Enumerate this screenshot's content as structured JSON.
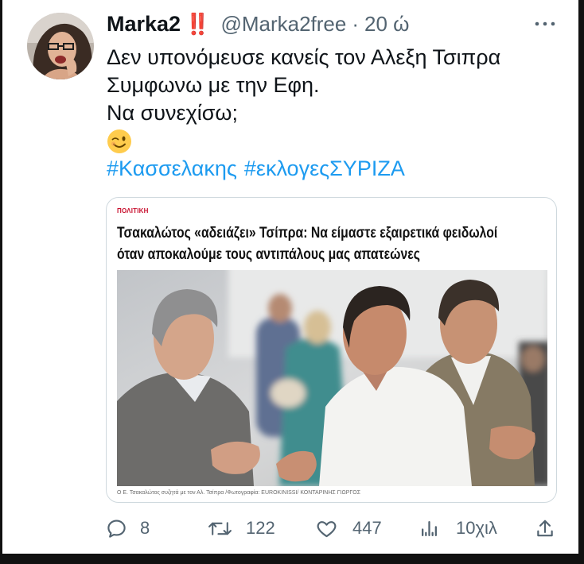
{
  "tweet": {
    "author": {
      "avatar_icon": "avatar",
      "display_name": "Marka2",
      "name_emoji": "‼️",
      "handle": "@Marka2free",
      "separator": "·",
      "time": "20 ώ"
    },
    "more_icon": "more-horizontal-icon",
    "text_lines": [
      "Δεν υπονόμευσε κανείς τον Αλεξη Τσιπρα",
      "Συμφωνω με την Εφη.",
      "Να συνεχίσω;"
    ],
    "emoji_icon": "winking-face-emoji",
    "hashtags": [
      "#Κασσελακης",
      "#εκλογεςΣΥΡΙΖΑ"
    ],
    "card": {
      "category": "ΠΟΛΙΤΙΚΗ",
      "headline_lines": [
        "Τσακαλώτος «αδειάζει» Τσίπρα: Να είμαστε εξαιρετικά φειδωλοί",
        "όταν αποκαλούμε τους αντιπάλους μας απατεώνες"
      ],
      "photo_icon": "article-photo",
      "caption": "Ο Ε. Τσακαλώτος συζητά με τον Αλ. Τσίπρα /Φωτογραφία: EUROKINISSI/ ΚΟΝΤΑΡΙΝΗΣ ΓΙΩΡΓΟΣ"
    },
    "actions": {
      "reply": {
        "icon": "reply-icon",
        "count": "8"
      },
      "retweet": {
        "icon": "retweet-icon",
        "count": "122"
      },
      "like": {
        "icon": "heart-icon",
        "count": "447"
      },
      "views": {
        "icon": "views-icon",
        "count": "10χιλ"
      },
      "share": {
        "icon": "share-icon"
      }
    }
  },
  "colors": {
    "text": "#0f1419",
    "secondary": "#536471",
    "link": "#1d9bf0",
    "card_border": "#cfd9de",
    "name_emoji": "#e0242f",
    "category": "#c8102e",
    "frame": "#111111",
    "headline": "#111111",
    "caption": "#6b6b6b"
  }
}
